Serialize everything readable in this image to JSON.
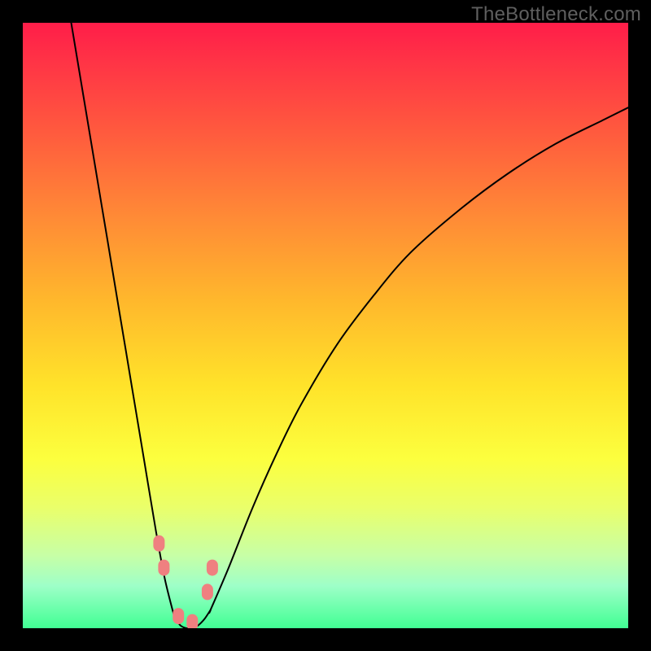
{
  "watermark": "TheBottleneck.com",
  "colors": {
    "frame": "#000000",
    "curve": "#000000",
    "marker": "#ef8080",
    "gradient_top": "#ff1d49",
    "gradient_bottom": "#41ff94"
  },
  "chart_data": {
    "type": "line",
    "title": "",
    "xlabel": "",
    "ylabel": "",
    "xlim": [
      0,
      100
    ],
    "ylim": [
      0,
      100
    ],
    "grid": false,
    "legend": false,
    "note": "Axes are implicit percent scales (0–100). y is bottleneck severity (0 = none/green, 100 = severe/red). Curve shows a V-shaped well with minimum near x≈27.",
    "series": [
      {
        "name": "left-branch",
        "x": [
          8,
          10,
          12,
          14,
          16,
          18,
          20,
          22,
          23.5,
          25
        ],
        "y": [
          100,
          88,
          76,
          64,
          52,
          40,
          28,
          16,
          8,
          2
        ]
      },
      {
        "name": "valley-floor",
        "x": [
          25,
          26,
          27,
          28,
          29,
          30,
          31
        ],
        "y": [
          2,
          0.5,
          0,
          0,
          0.5,
          1.5,
          3
        ]
      },
      {
        "name": "right-branch",
        "x": [
          31,
          34,
          38,
          42,
          46,
          52,
          58,
          64,
          72,
          80,
          88,
          96,
          100
        ],
        "y": [
          3,
          10,
          20,
          29,
          37,
          47,
          55,
          62,
          69,
          75,
          80,
          84,
          86
        ]
      }
    ],
    "markers": [
      {
        "name": "left-marker-upper",
        "x": 22.5,
        "y": 14
      },
      {
        "name": "left-marker-lower",
        "x": 23.3,
        "y": 10
      },
      {
        "name": "floor-marker-left",
        "x": 25.7,
        "y": 2
      },
      {
        "name": "floor-marker-mid",
        "x": 28.0,
        "y": 1
      },
      {
        "name": "right-marker-lower",
        "x": 30.5,
        "y": 6
      },
      {
        "name": "right-marker-upper",
        "x": 31.3,
        "y": 10
      }
    ]
  }
}
